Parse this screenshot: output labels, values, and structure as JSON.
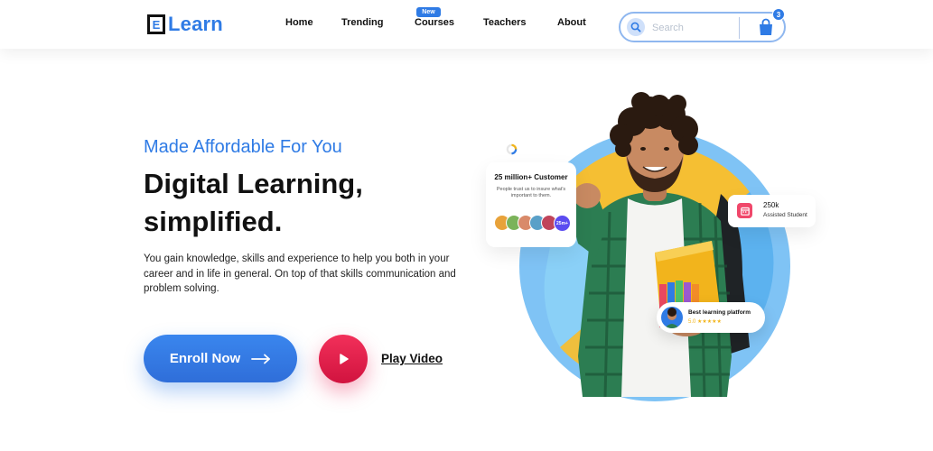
{
  "brand": {
    "logo_letter": "E",
    "logo_text": "Learn",
    "accent": "#2f7be5"
  },
  "nav": {
    "items": [
      {
        "label": "Home"
      },
      {
        "label": "Trending"
      },
      {
        "label": "Courses",
        "badge": "New"
      },
      {
        "label": "Teachers"
      },
      {
        "label": "About"
      }
    ]
  },
  "search": {
    "placeholder": "Search",
    "icon": "search-icon"
  },
  "cart": {
    "icon": "shopping-bag-icon",
    "count": "3"
  },
  "hero": {
    "eyebrow": "Made Affordable For You",
    "headline_line1": "Digital Learning,",
    "headline_line2": "simplified.",
    "description": "You gain knowledge, skills and experience to help you both in your career and in life in general. On top of that skills communication and problem solving.",
    "enroll_label": "Enroll Now",
    "play_label": "Play Video",
    "colors": {
      "eyebrow": "#2f7be5",
      "enroll": "#2f7be5",
      "play": "#e91e50"
    }
  },
  "customers_card": {
    "title": "25 million+ Customer",
    "subtitle": "People trust us to insure what's important to them.",
    "more_label": "25m+"
  },
  "students_card": {
    "count": "250k",
    "label": "Assisted Student",
    "icon": "calendar-icon"
  },
  "platform_card": {
    "title": "Best learning platform",
    "rating": "5.0",
    "stars": "★★★★★"
  }
}
